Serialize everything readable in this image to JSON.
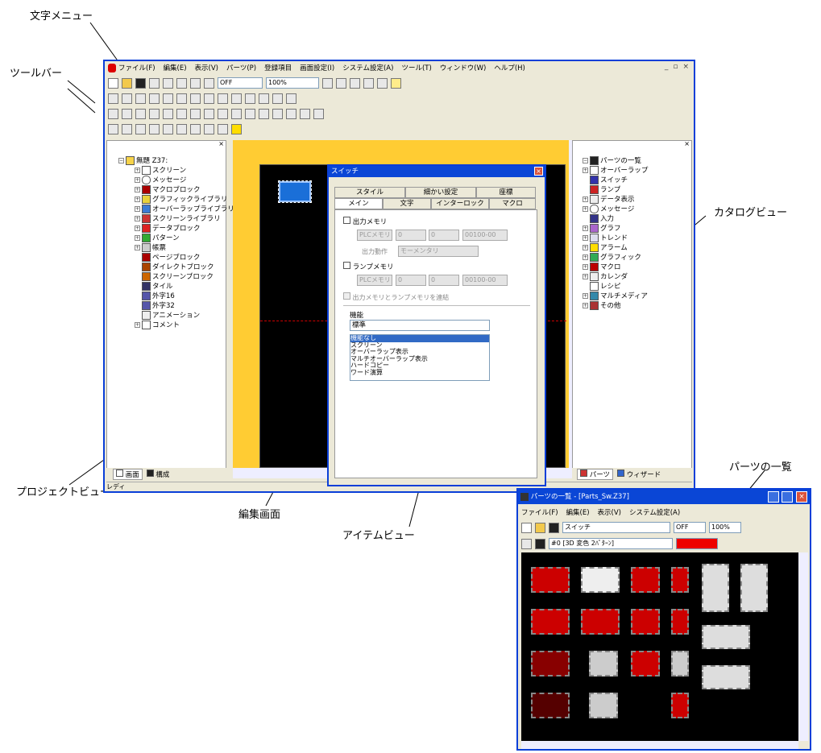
{
  "callouts": {
    "text_menu": "文字メニュー",
    "toolbar": "ツールバー",
    "catalog_view": "カタログビュー",
    "parts_list": "パーツの一覧",
    "project_view": "プロジェクトビュー",
    "edit_screen": "編集画面",
    "item_view": "アイテムビュー"
  },
  "main_window": {
    "menu": [
      "ファイル(F)",
      "編集(E)",
      "表示(V)",
      "パーツ(P)",
      "登録項目",
      "画面設定(I)",
      "システム設定(A)",
      "ツール(T)",
      "ウィンドウ(W)",
      "ヘルプ(H)"
    ],
    "window_controls": [
      "_",
      "▫",
      "×"
    ],
    "toolbar": {
      "off_label": "OFF",
      "zoom": "100%"
    },
    "status": "レディ"
  },
  "project_tree": {
    "root": "無題 Z37:",
    "items": [
      "スクリーン",
      "メッセージ",
      "マクロブロック",
      "グラフィックライブラリ",
      "オーバーラップライブラリ",
      "スクリーンライブラリ",
      "データブロック",
      "パターン",
      "帳票",
      "ページブロック",
      "ダイレクトブロック",
      "スクリーンブロック",
      "タイル",
      "外字16",
      "外字32",
      "アニメーション",
      "コメント"
    ],
    "tabs": [
      "画面",
      "構成"
    ]
  },
  "switch_dialog": {
    "title": "スイッチ",
    "tabs_row1": [
      "スタイル",
      "細かい設定",
      "座標"
    ],
    "tabs_row2": [
      "メイン",
      "文字",
      "インターロック",
      "マクロ"
    ],
    "output_memory": "出力メモリ",
    "plc_memory": "PLCメモリ",
    "num0": "0",
    "num0b": "0",
    "address": "00100-00",
    "output_action_label": "出力動作",
    "output_action_value": "モーメンタリ",
    "lamp_memory": "ランプメモリ",
    "link_memories": "出力メモリとランプメモリを連結",
    "function_label": "機能",
    "function_value": "標準",
    "function_list": [
      "機能なし",
      "スクリーン",
      "オーバーラップ表示",
      "マルチオーバーラップ表示",
      "ハードコピー",
      "ワード演算"
    ]
  },
  "catalog_tree": {
    "items": [
      "パーツの一覧",
      "オーバーラップ",
      "スイッチ",
      "ランプ",
      "データ表示",
      "メッセージ",
      "入力",
      "グラフ",
      "トレンド",
      "アラーム",
      "グラフィック",
      "マクロ",
      "カレンダ",
      "レシピ",
      "マルチメディア",
      "その他"
    ],
    "tabs": [
      "パーツ",
      "ウィザード"
    ]
  },
  "parts_window": {
    "title": "パーツの一覧 - [Parts_Sw.Z37]",
    "menu": [
      "ファイル(F)",
      "編集(E)",
      "表示(V)",
      "システム設定(A)"
    ],
    "type_select": "スイッチ",
    "off_label": "OFF",
    "zoom": "100%",
    "variant_select": "#0 [3D 変色 2ﾊﾟﾀｰﾝ]"
  },
  "colors": {
    "accent": "#0a3fd8",
    "part_red": "#cc0000",
    "canvas": "#000000",
    "frame": "#ffcc33"
  }
}
